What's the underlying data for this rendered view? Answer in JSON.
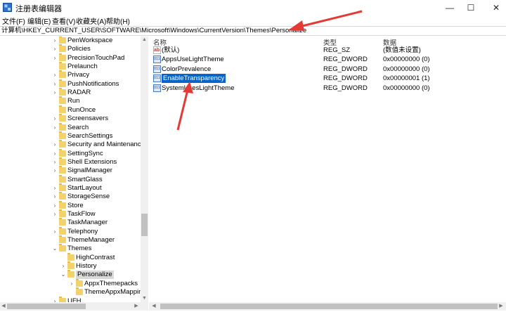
{
  "window": {
    "title": "注册表编辑器",
    "minimize_glyph": "—",
    "maximize_glyph": "☐",
    "close_glyph": "✕"
  },
  "menu": [
    "文件(F)",
    "编辑(E)",
    "查看(V)",
    "收藏夹(A)",
    "帮助(H)"
  ],
  "address": "计算机\\HKEY_CURRENT_USER\\SOFTWARE\\Microsoft\\Windows\\CurrentVersion\\Themes\\Personalize",
  "tree": {
    "items": [
      {
        "label": "PenWorkspace",
        "expander": "›"
      },
      {
        "label": "Policies",
        "expander": "›"
      },
      {
        "label": "PrecisionTouchPad",
        "expander": "›"
      },
      {
        "label": "Prelaunch",
        "expander": ""
      },
      {
        "label": "Privacy",
        "expander": "›"
      },
      {
        "label": "PushNotifications",
        "expander": "›"
      },
      {
        "label": "RADAR",
        "expander": "›"
      },
      {
        "label": "Run",
        "expander": ""
      },
      {
        "label": "RunOnce",
        "expander": ""
      },
      {
        "label": "Screensavers",
        "expander": "›"
      },
      {
        "label": "Search",
        "expander": "›"
      },
      {
        "label": "SearchSettings",
        "expander": ""
      },
      {
        "label": "Security and Maintenance",
        "expander": "›"
      },
      {
        "label": "SettingSync",
        "expander": "›"
      },
      {
        "label": "Shell Extensions",
        "expander": "›"
      },
      {
        "label": "SignalManager",
        "expander": "›"
      },
      {
        "label": "SmartGlass",
        "expander": ""
      },
      {
        "label": "StartLayout",
        "expander": "›"
      },
      {
        "label": "StorageSense",
        "expander": "›"
      },
      {
        "label": "Store",
        "expander": "›"
      },
      {
        "label": "TaskFlow",
        "expander": "›"
      },
      {
        "label": "TaskManager",
        "expander": ""
      },
      {
        "label": "Telephony",
        "expander": "›"
      },
      {
        "label": "ThemeManager",
        "expander": ""
      },
      {
        "label": "Themes",
        "expander": "⌄"
      },
      {
        "label": "HighContrast",
        "expander": ""
      },
      {
        "label": "History",
        "expander": "›"
      },
      {
        "label": "Personalize",
        "expander": "⌄"
      },
      {
        "label": "AppxThemepacks",
        "expander": "›"
      },
      {
        "label": "ThemeAppxMappings",
        "expander": ""
      },
      {
        "label": "UFH",
        "expander": "›"
      }
    ]
  },
  "list": {
    "columns": {
      "name": "名称",
      "type": "类型",
      "data": "数据"
    },
    "rows": [
      {
        "name": "(默认)",
        "type": "REG_SZ",
        "data": "(数值未设置)",
        "icon": "string-value-icon"
      },
      {
        "name": "AppsUseLightTheme",
        "type": "REG_DWORD",
        "data": "0x00000000 (0)",
        "icon": "dword-value-icon"
      },
      {
        "name": "ColorPrevalence",
        "type": "REG_DWORD",
        "data": "0x00000000 (0)",
        "icon": "dword-value-icon"
      },
      {
        "name": "EnableTransparency",
        "type": "REG_DWORD",
        "data": "0x00000001 (1)",
        "icon": "dword-value-icon"
      },
      {
        "name": "SystemUsesLightTheme",
        "type": "REG_DWORD",
        "data": "0x00000000 (0)",
        "icon": "dword-value-icon"
      }
    ]
  },
  "colors": {
    "selection": "#0a64c8",
    "annotation_arrow": "#e53935",
    "folder": "#f3d26b"
  }
}
